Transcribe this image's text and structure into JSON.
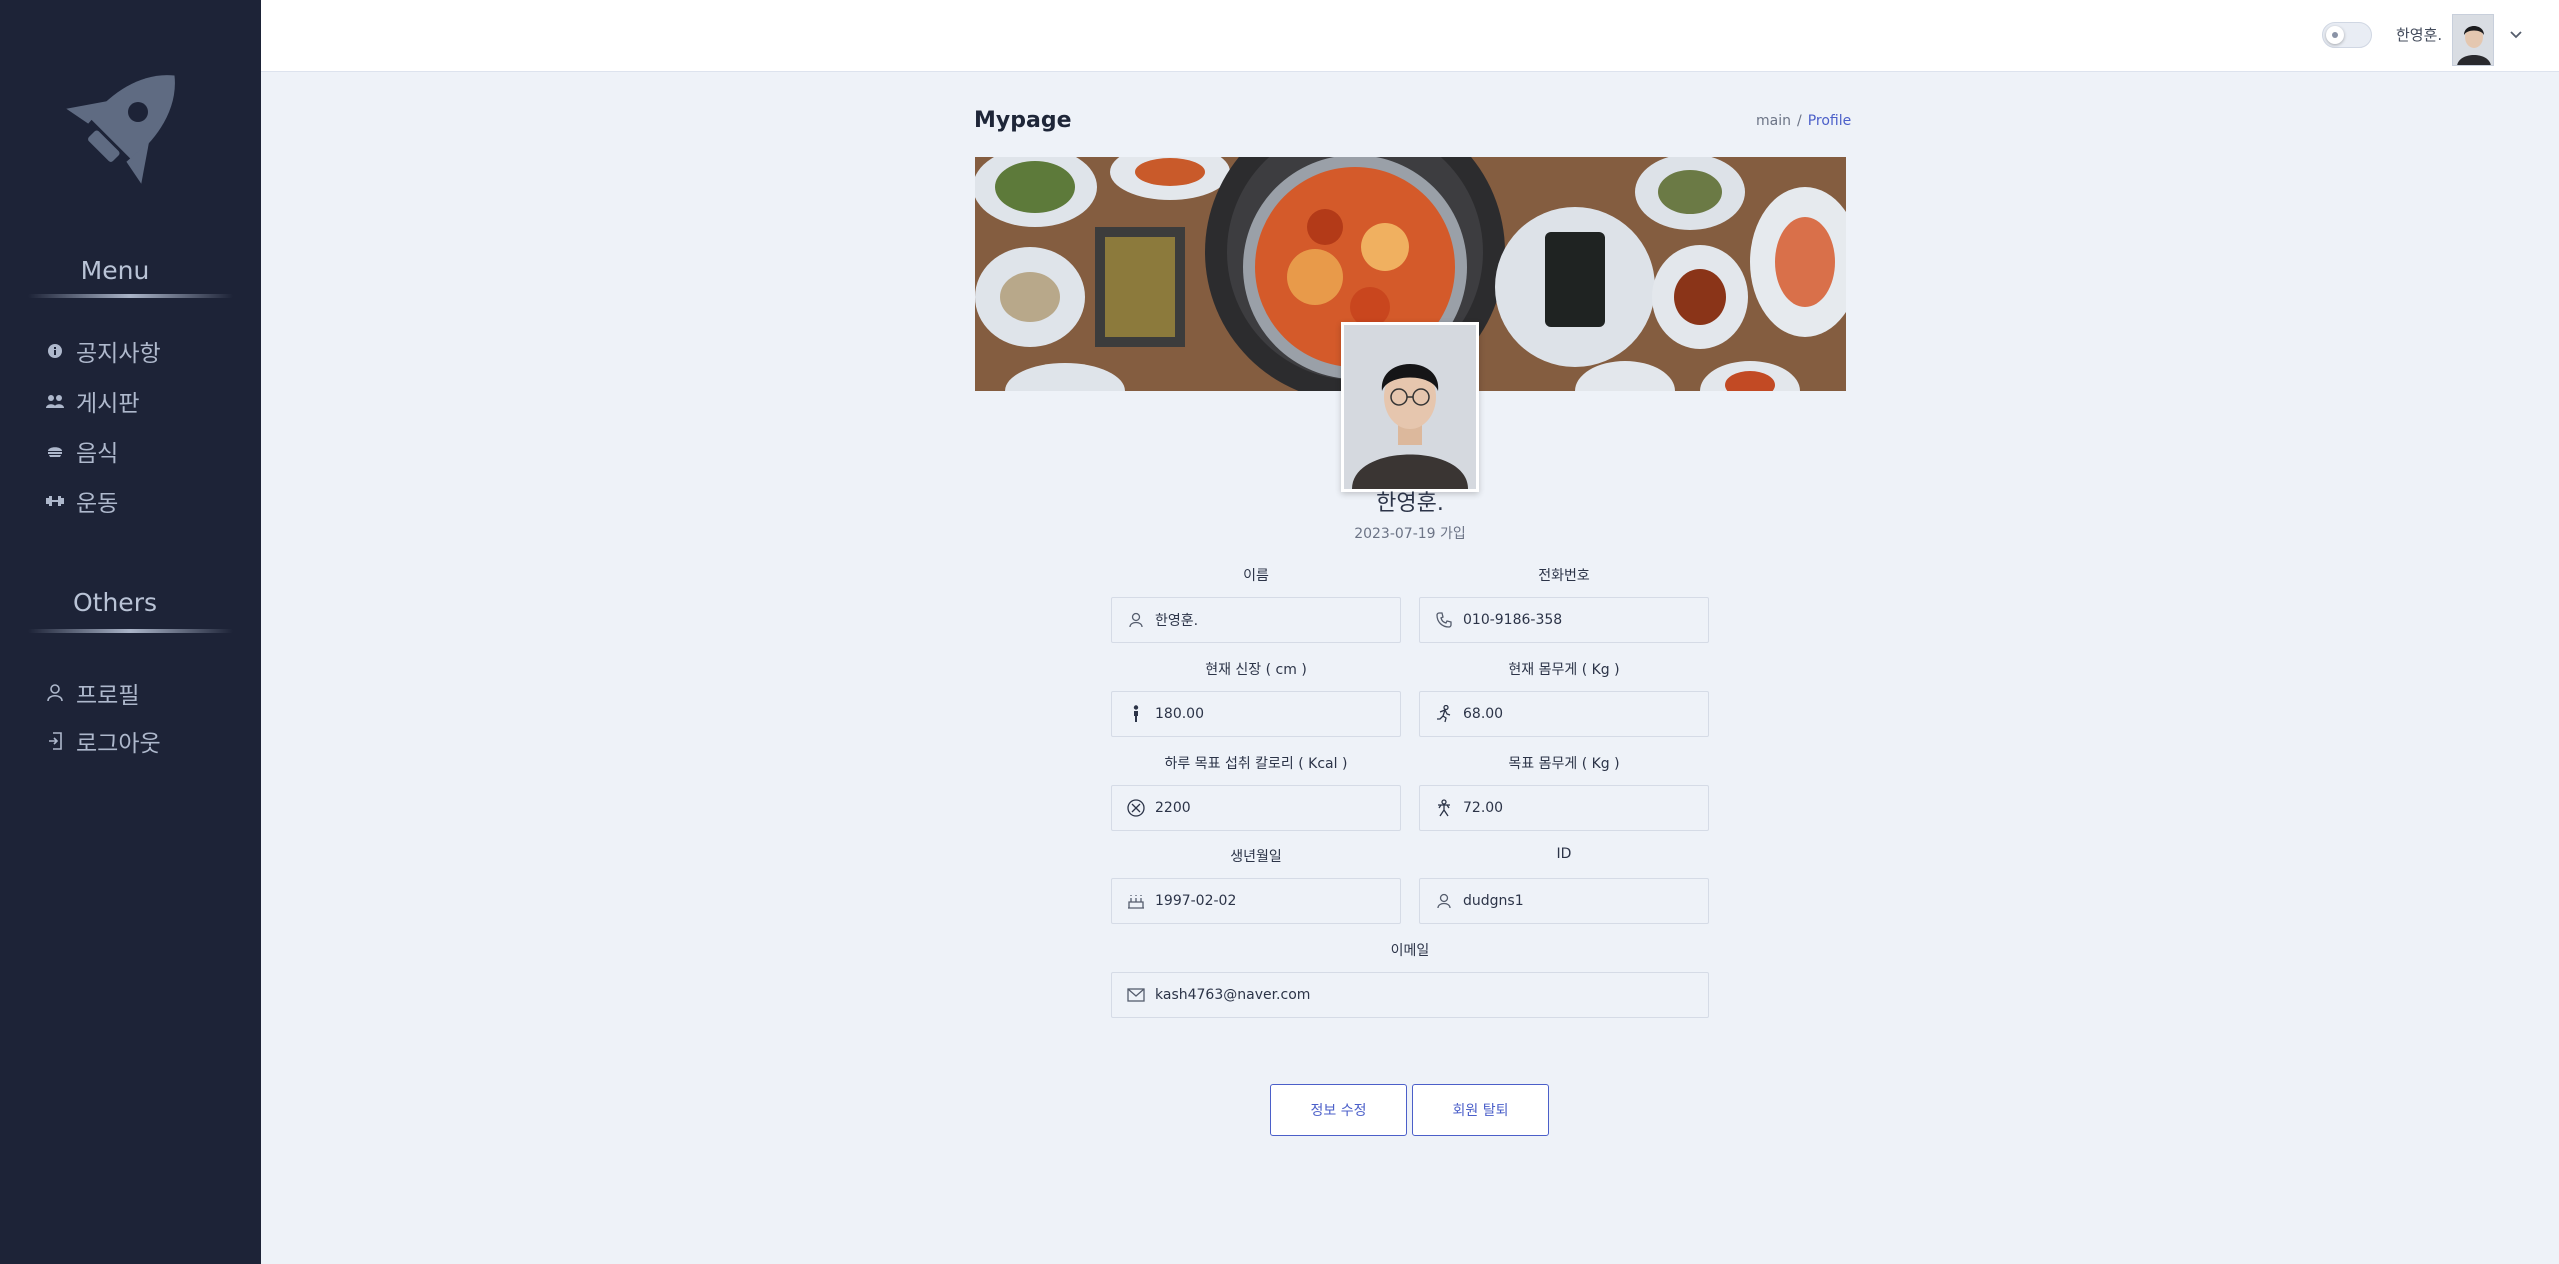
{
  "sidebar": {
    "menu_title": "Menu",
    "menu_items": [
      {
        "label": "공지사항",
        "icon": "info-icon"
      },
      {
        "label": "게시판",
        "icon": "users-icon"
      },
      {
        "label": "음식",
        "icon": "food-icon"
      },
      {
        "label": "운동",
        "icon": "dumbbell-icon"
      }
    ],
    "others_title": "Others",
    "others_items": [
      {
        "label": "프로필",
        "icon": "user-icon"
      },
      {
        "label": "로그아웃",
        "icon": "logout-icon"
      }
    ]
  },
  "topbar": {
    "username": "한영훈."
  },
  "page": {
    "title": "Mypage",
    "breadcrumb": [
      "main",
      "Profile"
    ]
  },
  "profile": {
    "name": "한영훈.",
    "join_date": "2023-07-19 가입"
  },
  "fields": {
    "name": {
      "label": "이름",
      "value": "한영훈."
    },
    "phone": {
      "label": "전화번호",
      "value": "010-9186-358"
    },
    "height": {
      "label": "현재 신장 ( cm )",
      "value": "180.00"
    },
    "weight": {
      "label": "현재 몸무게 ( Kg )",
      "value": "68.00"
    },
    "calorie": {
      "label": "하루 목표 섭취 칼로리 ( Kcal )",
      "value": "2200"
    },
    "goal_weight": {
      "label": "목표 몸무게 ( Kg )",
      "value": "72.00"
    },
    "birth": {
      "label": "생년월일",
      "value": "1997-02-02"
    },
    "id": {
      "label": "ID",
      "value": "dudgns1"
    },
    "email": {
      "label": "이메일",
      "value": "kash4763@naver.com"
    }
  },
  "buttons": {
    "edit": "정보 수정",
    "withdraw": "회원 탈퇴"
  },
  "colors": {
    "sidebar_bg": "#1d2337",
    "accent": "#4b5fc9",
    "content_bg": "#eef2f8"
  }
}
